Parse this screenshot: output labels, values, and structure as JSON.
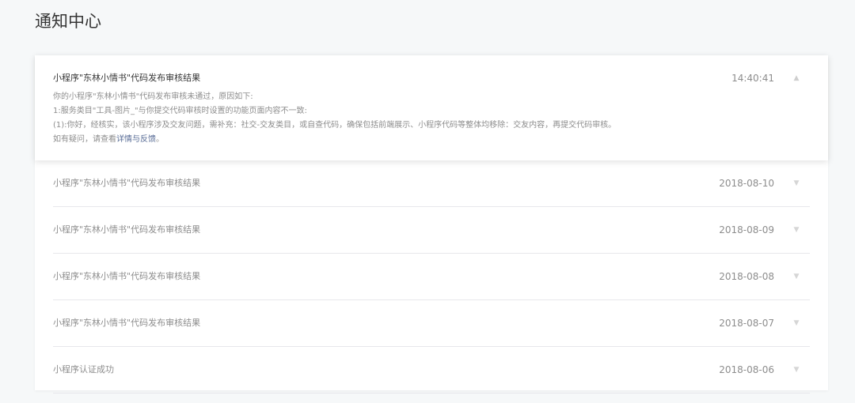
{
  "page": {
    "title": "通知中心"
  },
  "expanded": {
    "title": "小程序\"东林小情书\"代码发布审核结果",
    "time": "14:40:41",
    "arrow_icon": "chevron-up-icon",
    "lines": [
      "你的小程序\"东林小情书\"代码发布审核未通过，原因如下:",
      "1:服务类目\"工具-图片_\"与你提交代码审核时设置的功能页面内容不一致:",
      "(1):你好，经核实，该小程序涉及交友问题，需补充：社交-交友类目，或自查代码，确保包括前端展示、小程序代码等整体均移除：交友内容，再提交代码审核。"
    ],
    "footer_prefix": "如有疑问，请查看",
    "footer_link": "详情与反馈",
    "footer_suffix": "。"
  },
  "notifications": [
    {
      "title": "小程序\"东林小情书\"代码发布审核结果",
      "date": "2018-08-10"
    },
    {
      "title": "小程序\"东林小情书\"代码发布审核结果",
      "date": "2018-08-09"
    },
    {
      "title": "小程序\"东林小情书\"代码发布审核结果",
      "date": "2018-08-08"
    },
    {
      "title": "小程序\"东林小情书\"代码发布审核结果",
      "date": "2018-08-07"
    },
    {
      "title": "小程序认证成功",
      "date": "2018-08-06"
    }
  ],
  "icons": {
    "row_arrow": "chevron-down-icon"
  },
  "colors": {
    "link": "#576b95",
    "muted_text": "#8d8d8d",
    "primary_text": "#353535",
    "background": "#f6f8f9",
    "divider": "#e7e7eb"
  }
}
